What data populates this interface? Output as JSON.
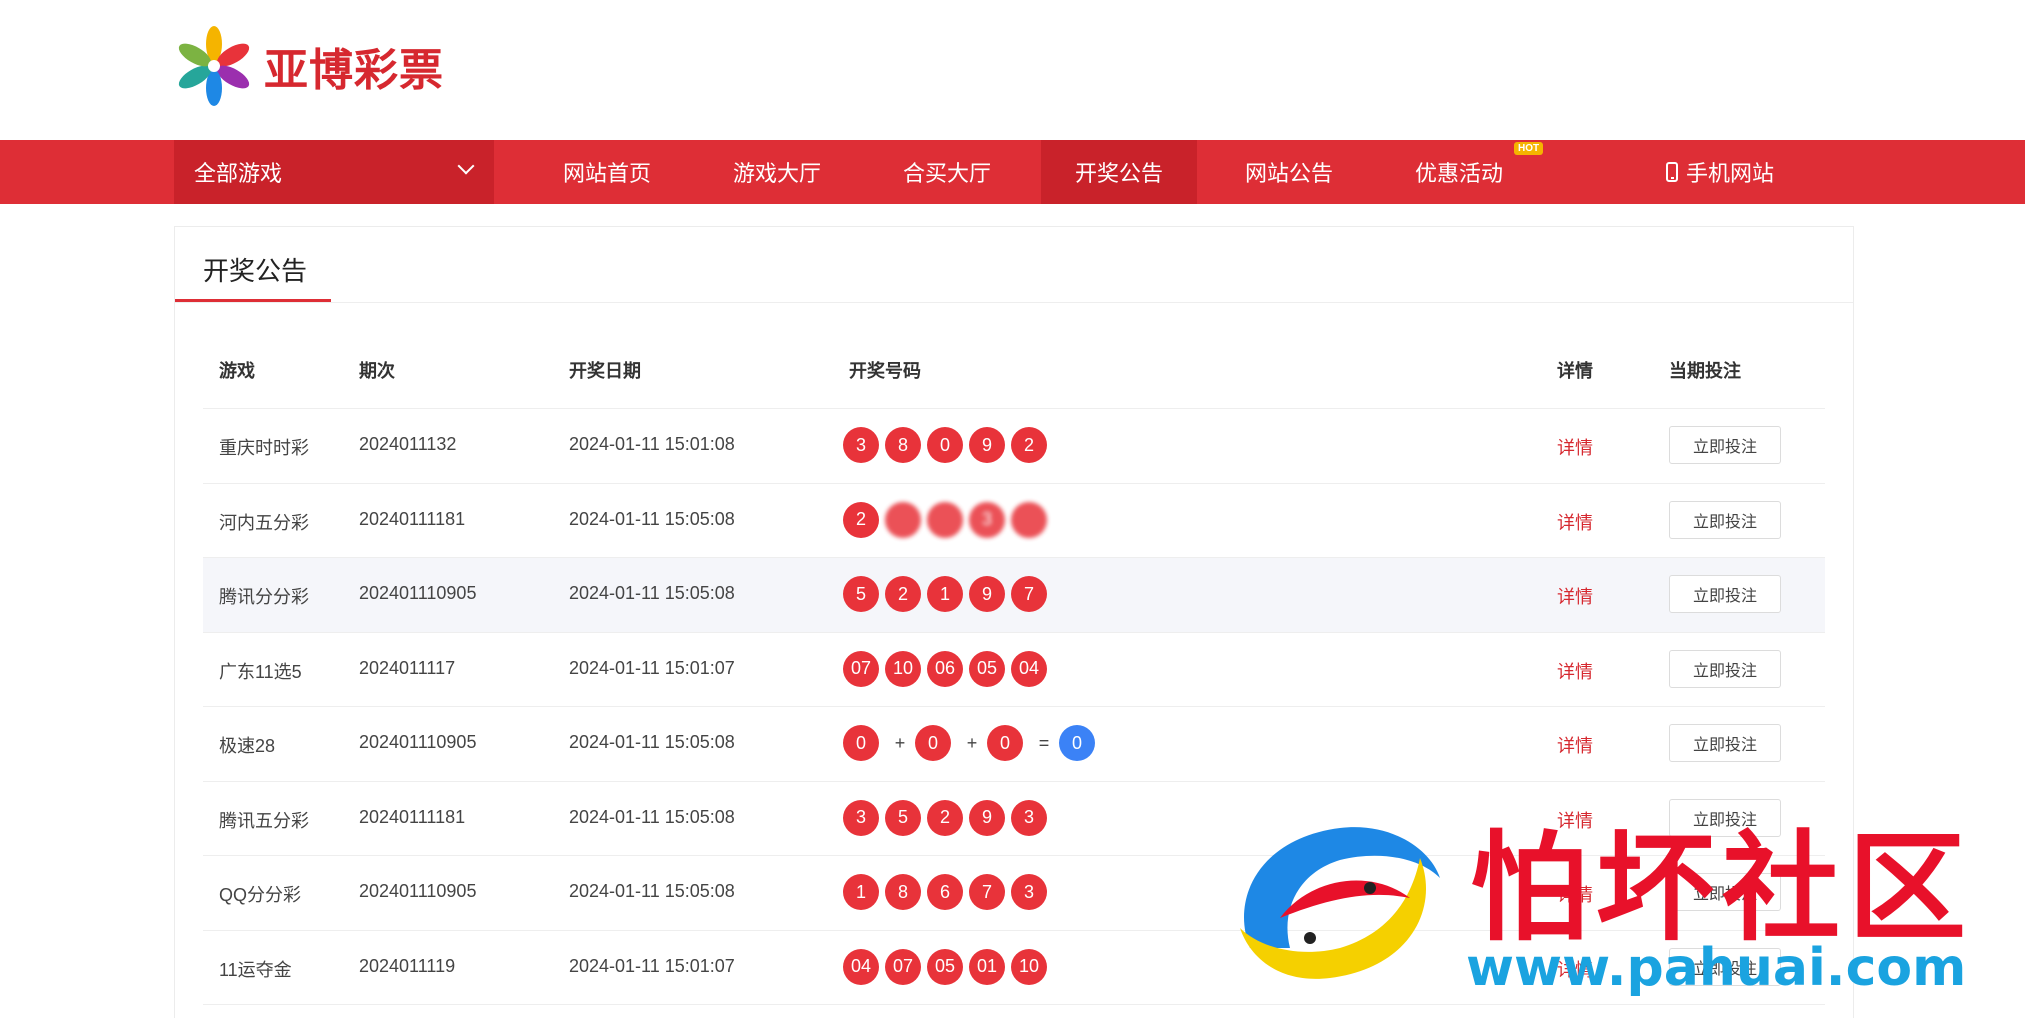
{
  "brand": {
    "name": "亚博彩票",
    "color": "#d6282f"
  },
  "nav": {
    "all_games": "全部游戏",
    "items": [
      {
        "label": "网站首页"
      },
      {
        "label": "游戏大厅"
      },
      {
        "label": "合买大厅"
      },
      {
        "label": "开奖公告",
        "active": true
      },
      {
        "label": "网站公告"
      },
      {
        "label": "优惠活动",
        "badge": "HOT"
      },
      {
        "label": "手机网站",
        "icon": "phone-icon"
      }
    ],
    "bg_color": "#de2e36",
    "active_color": "#c9222a"
  },
  "panel": {
    "title": "开奖公告"
  },
  "table": {
    "headers": [
      "游戏",
      "期次",
      "开奖日期",
      "开奖号码",
      "详情",
      "当期投注"
    ],
    "detail_label": "详情",
    "bet_label": "立即投注",
    "rows": [
      {
        "game": "重庆时时彩",
        "period": "2024011132",
        "date": "2024-01-11 15:01:08",
        "numbers": [
          "3",
          "8",
          "0",
          "9",
          "2"
        ]
      },
      {
        "game": "河内五分彩",
        "period": "20240111181",
        "date": "2024-01-11 15:05:08",
        "numbers": [
          "2",
          "",
          "",
          "3",
          ""
        ],
        "blurred": true
      },
      {
        "game": "腾讯分分彩",
        "period": "202401110905",
        "date": "2024-01-11 15:05:08",
        "numbers": [
          "5",
          "2",
          "1",
          "9",
          "7"
        ],
        "highlight": true
      },
      {
        "game": "广东11选5",
        "period": "2024011117",
        "date": "2024-01-11 15:01:07",
        "numbers": [
          "07",
          "10",
          "06",
          "05",
          "04"
        ]
      },
      {
        "game": "极速28",
        "period": "202401110905",
        "date": "2024-01-11 15:05:08",
        "sum28": [
          "0",
          "0",
          "0",
          "0"
        ]
      },
      {
        "game": "腾讯五分彩",
        "period": "20240111181",
        "date": "2024-01-11 15:05:08",
        "numbers": [
          "3",
          "5",
          "2",
          "9",
          "3"
        ]
      },
      {
        "game": "QQ分分彩",
        "period": "202401110905",
        "date": "2024-01-11 15:05:08",
        "numbers": [
          "1",
          "8",
          "6",
          "7",
          "3"
        ]
      },
      {
        "game": "11运夺金",
        "period": "2024011119",
        "date": "2024-01-11 15:01:07",
        "numbers": [
          "04",
          "07",
          "05",
          "01",
          "10"
        ]
      }
    ]
  },
  "watermark": {
    "title": "怕坏社区",
    "url": "www.pahuai.com"
  }
}
